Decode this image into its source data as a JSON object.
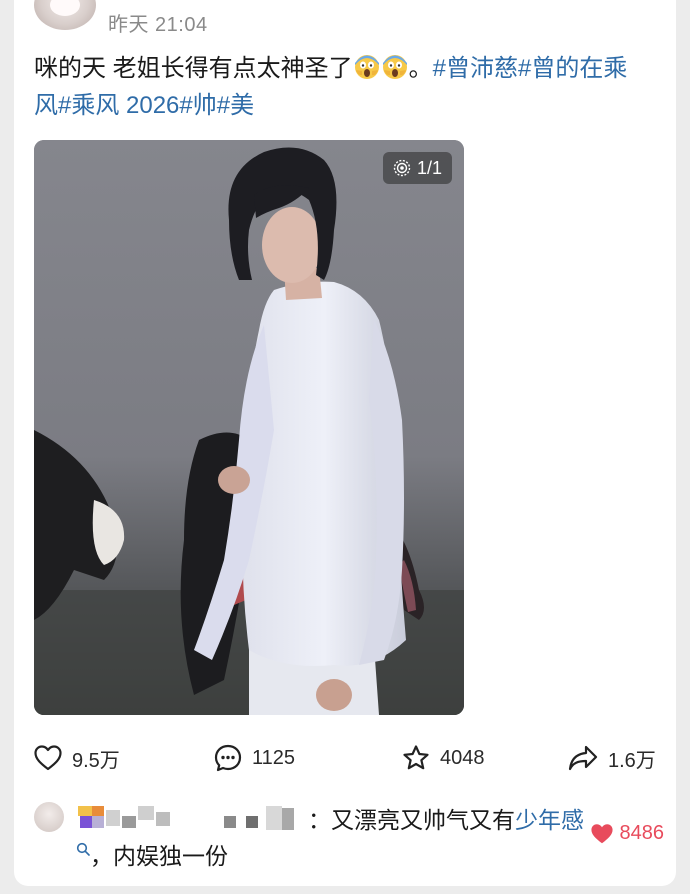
{
  "post": {
    "time": "昨天 21:04",
    "text_before": "咪的天 老姐长得有点太神圣了",
    "emojis": [
      "scream-emoji",
      "scream-emoji"
    ],
    "text_after": "。",
    "hashtags_line1": "#曾沛慈#曾的在乘",
    "hashtags_line2": "风#乘风 2026#帅#美"
  },
  "photo": {
    "counter": "1/1",
    "counter_icon": "live-photo-icon"
  },
  "actions": {
    "like_count": "9.5万",
    "comment_count": "1125",
    "favorite_count": "4048",
    "share_count": "1.6万"
  },
  "comment": {
    "colon": "：",
    "text_main": "又漂亮又帅气又有",
    "highlight": "少年感",
    "search_icon": "search-icon",
    "text_end": "，内娱独一份",
    "like_count": "8486",
    "like_color": "#e84b5c"
  },
  "colors": {
    "hashtag": "#2f6ca8",
    "text": "#1a1a1a",
    "muted": "#8a8a8a"
  }
}
